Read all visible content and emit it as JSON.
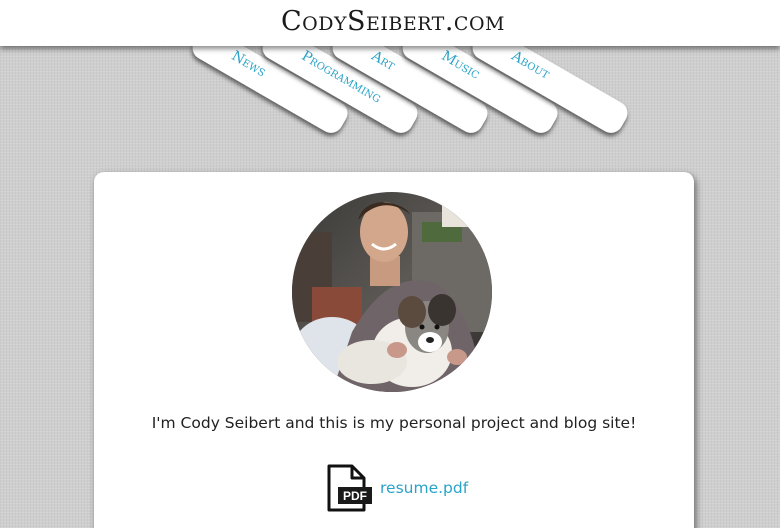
{
  "site": {
    "title": "CodySeibert.com"
  },
  "nav": {
    "items": [
      {
        "label": "News"
      },
      {
        "label": "Programming"
      },
      {
        "label": "Art"
      },
      {
        "label": "Music"
      },
      {
        "label": "About"
      }
    ]
  },
  "profile": {
    "intro": "I'm Cody Seibert and this is my personal project and blog site!",
    "resume_label": "resume.pdf",
    "pdf_badge": "PDF"
  },
  "colors": {
    "accent": "#2aa3c8",
    "background": "#cfcfcf",
    "card": "#ffffff"
  }
}
